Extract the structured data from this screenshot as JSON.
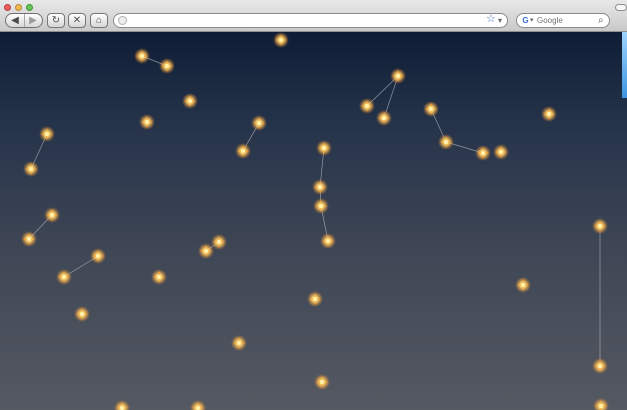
{
  "browser": {
    "address_value": "",
    "address_placeholder": "",
    "search_placeholder": "Google",
    "search_provider_label": "G"
  },
  "colors": {
    "sky_top": "#0e1d35",
    "sky_bottom": "#555962",
    "star_core": "#fff2a8",
    "star_glow": "#ffb347",
    "line": "#d8d8d8"
  },
  "icons": {
    "back": "◀",
    "forward": "▶",
    "reload": "↻",
    "stop": "✕",
    "home": "⌂",
    "bookmark": "☆",
    "bookmark_chevron": "▾",
    "search_provider_chevron": "▾",
    "search": "⌕"
  }
}
